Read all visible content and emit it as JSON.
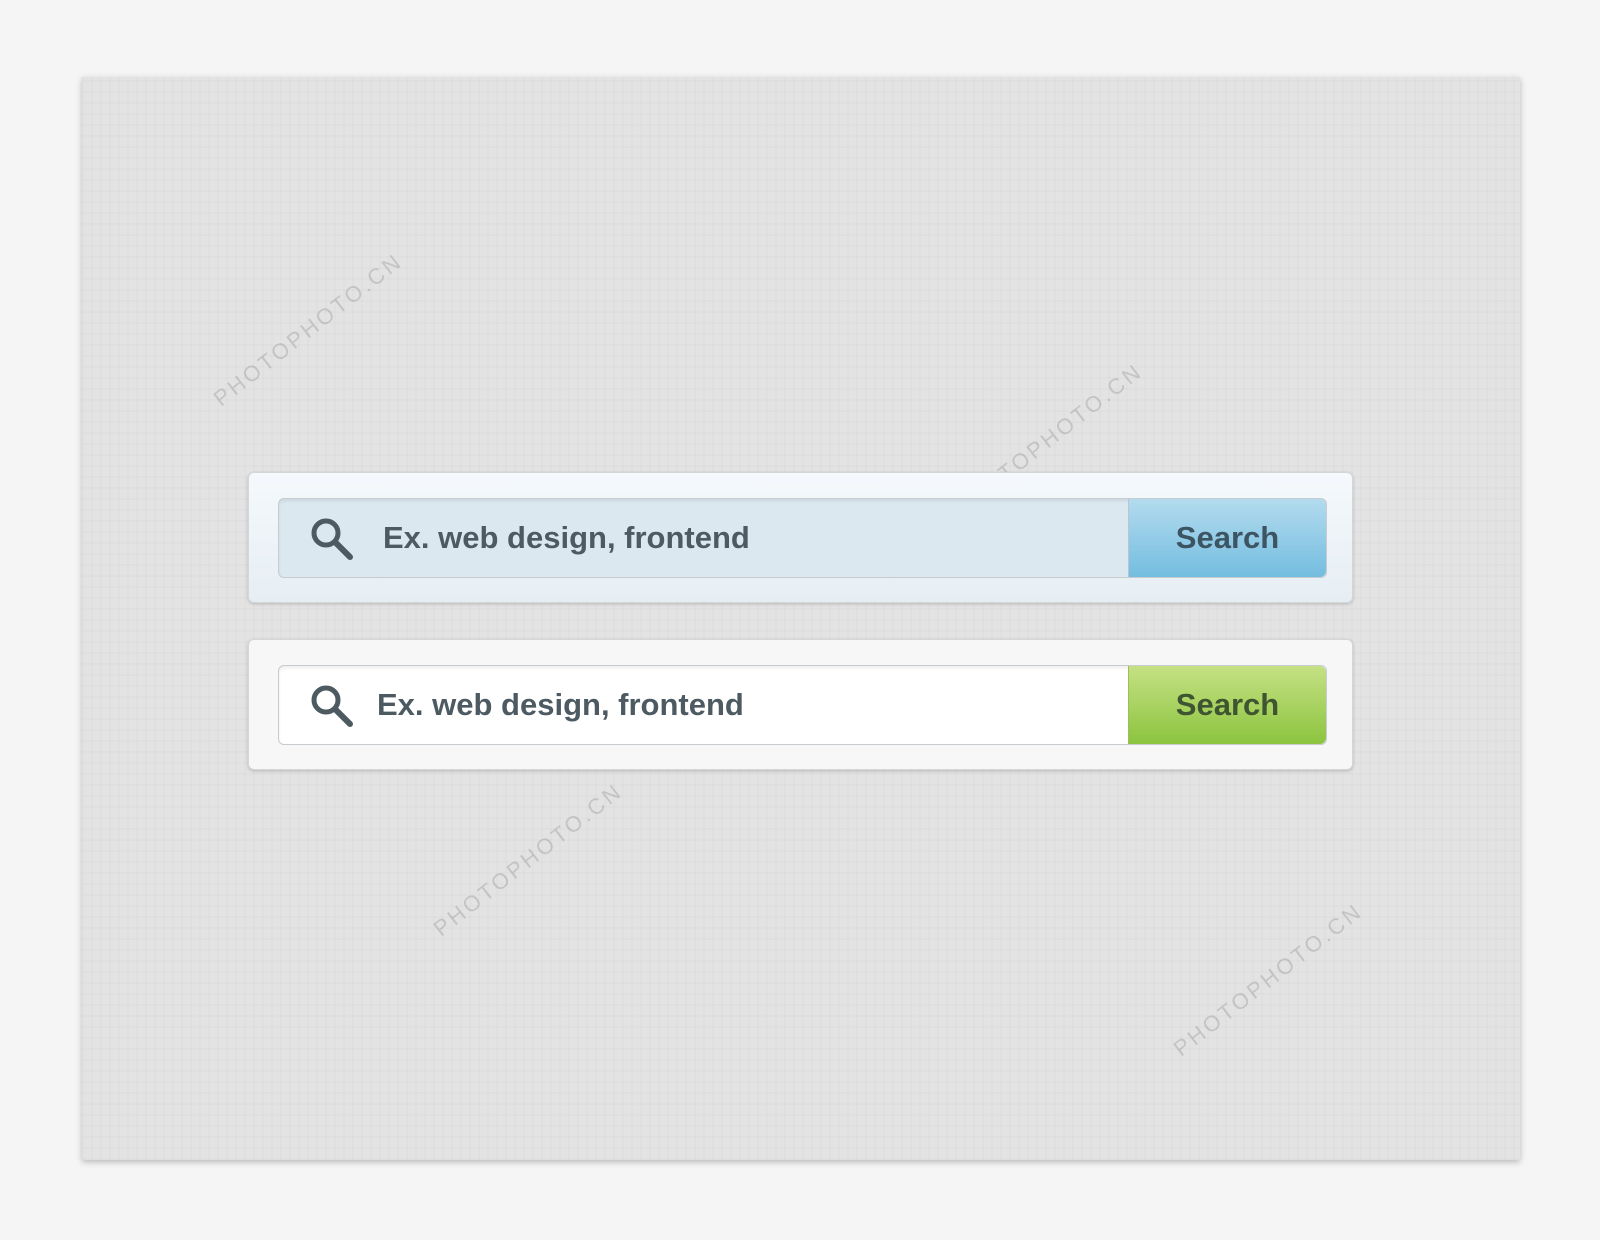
{
  "watermark": "PHOTOPHOTO.CN",
  "search_bars": [
    {
      "variant": "blue",
      "placeholder": "Ex. web design, frontend",
      "button_label": "Search",
      "icon": "search-icon",
      "accent": "#74bde0"
    },
    {
      "variant": "green",
      "placeholder": "Ex. web design, frontend",
      "button_label": "Search",
      "icon": "search-icon",
      "accent": "#8cc43f"
    }
  ]
}
